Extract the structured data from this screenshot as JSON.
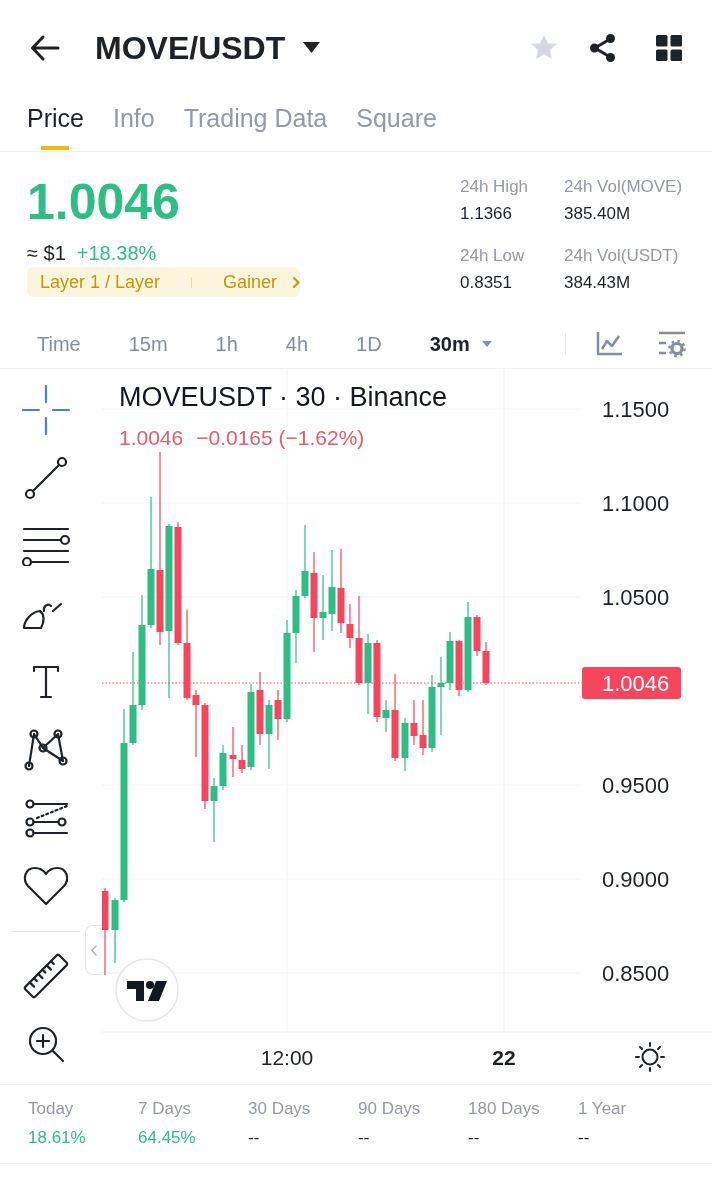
{
  "header": {
    "title": "MOVE/USDT",
    "favorited": false
  },
  "tabs": [
    {
      "label": "Price",
      "selected": true
    },
    {
      "label": "Info",
      "selected": false
    },
    {
      "label": "Trading Data",
      "selected": false
    },
    {
      "label": "Square",
      "selected": false
    }
  ],
  "ticker": {
    "price": "1.0046",
    "approx": "≈ $1",
    "change": "+18.38%",
    "tags": [
      "Layer 1 / Layer",
      "Gainer"
    ],
    "stats": [
      {
        "label": "24h High",
        "value": "1.1366"
      },
      {
        "label": "24h Vol(MOVE)",
        "value": "385.40M"
      },
      {
        "label": "24h Low",
        "value": "0.8351"
      },
      {
        "label": "24h Vol(USDT)",
        "value": "384.43M"
      }
    ]
  },
  "intervals": [
    {
      "label": "Time",
      "kind": "option",
      "selected": false
    },
    {
      "label": "15m",
      "kind": "option",
      "selected": false
    },
    {
      "label": "1h",
      "kind": "option",
      "selected": false
    },
    {
      "label": "4h",
      "kind": "option",
      "selected": false
    },
    {
      "label": "1D",
      "kind": "option",
      "selected": false
    },
    {
      "label": "30m",
      "kind": "dropdown",
      "selected": true
    }
  ],
  "chart": {
    "legend": {
      "symbol": "MOVEUSDT · 30 · Binance",
      "close": "1.0046",
      "change": "−0.0165 (−1.62%)"
    },
    "price_axis": [
      "1.1500",
      "1.1000",
      "1.0500",
      "0.9500",
      "0.9000",
      "0.8500"
    ],
    "last_price": "1.0046",
    "time_axis": [
      {
        "label": "12:00",
        "kind": "time"
      },
      {
        "label": "22",
        "kind": "date"
      }
    ]
  },
  "performance": [
    {
      "label": "Today",
      "value": "18.61%",
      "positive": true
    },
    {
      "label": "7 Days",
      "value": "64.45%",
      "positive": true
    },
    {
      "label": "30 Days",
      "value": "--",
      "positive": false
    },
    {
      "label": "90 Days",
      "value": "--",
      "positive": false
    },
    {
      "label": "180 Days",
      "value": "--",
      "positive": false
    },
    {
      "label": "1 Year",
      "value": "--",
      "positive": false
    }
  ]
}
